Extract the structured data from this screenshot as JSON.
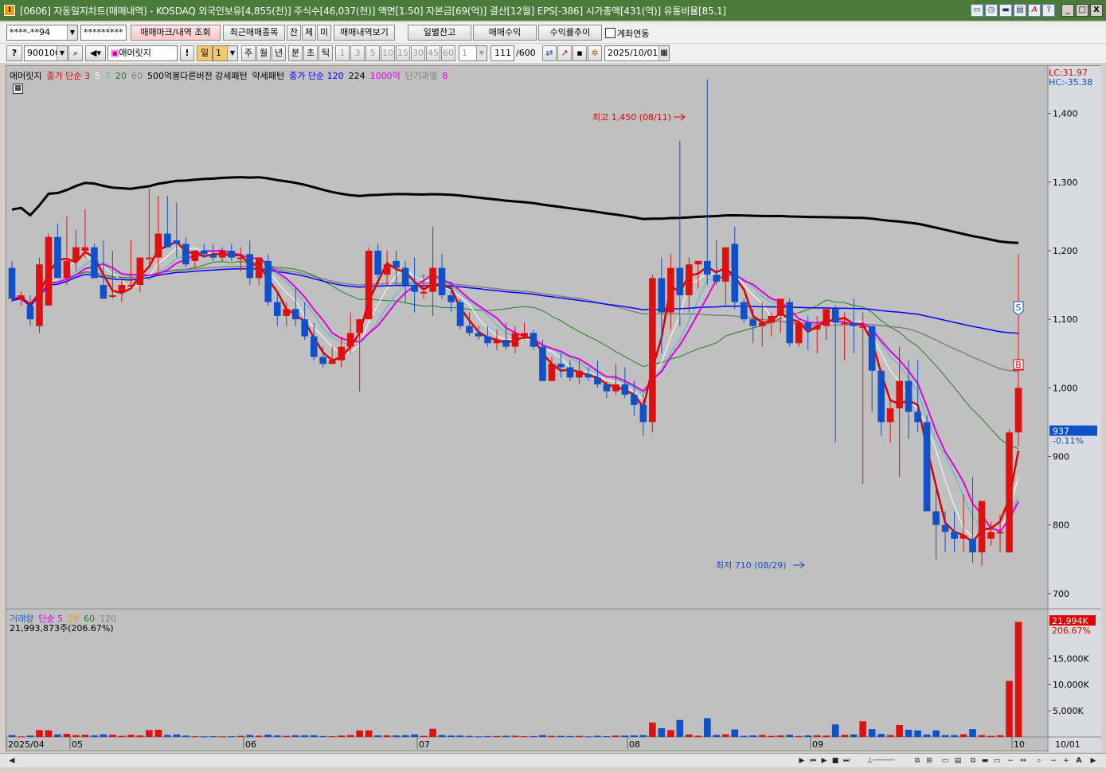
{
  "window": {
    "title": "[0606] 자동일지차트(매매내역) - KOSDAQ 외국인보유[4,855(천)] 주식수[46,037(천)] 액면[1.50] 자본금[69(억)] 결산[12월] EPS[-386] 시가총액[431(억)] 유통비율[85.1]",
    "controls": [
      "▭",
      "◷",
      "▬",
      "▤",
      "A",
      "?",
      "_",
      "□",
      "X"
    ]
  },
  "toolbar1": {
    "account": "****-**94",
    "password": "*********",
    "btn_mark": "매매마크/내역 조회",
    "btn_recent": "최근매매종목",
    "small": [
      "잔",
      "체",
      "미"
    ],
    "btn_history": "매매내역보기",
    "btn_balance": "일별잔고",
    "btn_profit": "매매수익",
    "btn_rate": "수익률추이",
    "chk_link": "계좌연동"
  },
  "toolbar2": {
    "code": "900100",
    "name": "애머릿지",
    "periods": [
      "일",
      "1",
      "주",
      "월",
      "년",
      "분",
      "초",
      "틱"
    ],
    "nums": [
      "1",
      "3",
      "5",
      "10",
      "15",
      "30",
      "45",
      "60"
    ],
    "interval": "1",
    "count": "111",
    "max": "/600",
    "date": "2025/10/01"
  },
  "price_legend": [
    {
      "text": "애머릿지",
      "color": "#000000"
    },
    {
      "text": "종가 단순 3",
      "color": "#e00000"
    },
    {
      "text": "5",
      "color": "#ffffff"
    },
    {
      "text": "7",
      "color": "#40c0c0"
    },
    {
      "text": "20",
      "color": "#208020"
    },
    {
      "text": "60",
      "color": "#808080"
    },
    {
      "text": "500억봉다른버전 강세패턴",
      "color": "#000000"
    },
    {
      "text": "약세패턴",
      "color": "#000000"
    },
    {
      "text": "종가 단순 120",
      "color": "#0000ff"
    },
    {
      "text": "224",
      "color": "#000000"
    },
    {
      "text": "1000억",
      "color": "#e000e0"
    },
    {
      "text": "단기과열",
      "color": "#808080"
    },
    {
      "text": "8",
      "color": "#e000e0"
    }
  ],
  "price_axis": {
    "lc": "LC:31.97",
    "hc": "HC:-35.38",
    "ticks": [
      "1,400",
      "1,300",
      "1,200",
      "1,100",
      "1,000",
      "900",
      "800",
      "700"
    ],
    "current": "937",
    "change": "-0.11%"
  },
  "annotations": {
    "high": "최고 1,450 (08/11)",
    "low": "최저 710 (08/29)",
    "sell_marker": "S",
    "buy_marker": "B"
  },
  "volume_legend": [
    {
      "text": "거래량",
      "color": "#2060c0"
    },
    {
      "text": "단순 5",
      "color": "#e000e0"
    },
    {
      "text": "20",
      "color": "#e0a000"
    },
    {
      "text": "60",
      "color": "#208020"
    },
    {
      "text": "120",
      "color": "#808080"
    }
  ],
  "volume_info": "21,993,873주(206.67%)",
  "volume_axis": {
    "current": "21,994K",
    "pct": "206.67%",
    "ticks": [
      "15,000K",
      "10,000K",
      "5,000K"
    ]
  },
  "date_axis": [
    "2025/04",
    "05",
    "06",
    "07",
    "08",
    "09",
    "10",
    "10/01"
  ],
  "colors": {
    "up": "#e01010",
    "down": "#1050c8",
    "bg": "#c0c0c0"
  },
  "chart_data": {
    "type": "candlestick",
    "x": [
      "04/21",
      "04/22",
      "04/23",
      "04/24",
      "04/25",
      "04/28",
      "04/29",
      "04/30",
      "05/02",
      "05/06",
      "05/07",
      "05/08",
      "05/09",
      "05/12",
      "05/13",
      "05/14",
      "05/15",
      "05/16",
      "05/19",
      "05/20",
      "05/21",
      "05/22",
      "05/23",
      "05/26",
      "05/27",
      "05/28",
      "05/29",
      "05/30",
      "06/02",
      "06/04",
      "06/05",
      "06/09",
      "06/10",
      "06/11",
      "06/12",
      "06/13",
      "06/16",
      "06/17",
      "06/18",
      "06/19",
      "06/20",
      "06/23",
      "06/24",
      "06/25",
      "06/26",
      "06/27",
      "06/30",
      "07/01",
      "07/02",
      "07/03",
      "07/04",
      "07/07",
      "07/08",
      "07/09",
      "07/10",
      "07/11",
      "07/14",
      "07/15",
      "07/16",
      "07/17",
      "07/18",
      "07/21",
      "07/22",
      "07/23",
      "07/24",
      "07/25",
      "07/28",
      "07/29",
      "07/30",
      "07/31",
      "08/01",
      "08/04",
      "08/05",
      "08/06",
      "08/07",
      "08/08",
      "08/11",
      "08/12",
      "08/13",
      "08/14",
      "08/18",
      "08/19",
      "08/20",
      "08/21",
      "08/22",
      "08/25",
      "08/26",
      "08/27",
      "08/28",
      "08/29",
      "09/01",
      "09/02",
      "09/03",
      "09/04",
      "09/05",
      "09/08",
      "09/09",
      "09/10",
      "09/11",
      "09/12",
      "09/15",
      "09/16",
      "09/17",
      "09/18",
      "09/19",
      "09/22",
      "09/23",
      "09/24",
      "09/25",
      "09/26",
      "09/29",
      "09/30",
      "10/01"
    ],
    "ohlc": [
      [
        1175,
        1185,
        1125,
        1130
      ],
      [
        1130,
        1140,
        1120,
        1135
      ],
      [
        1120,
        1135,
        1090,
        1100
      ],
      [
        1090,
        1190,
        1080,
        1180
      ],
      [
        1120,
        1225,
        1120,
        1220
      ],
      [
        1220,
        1240,
        1160,
        1160
      ],
      [
        1160,
        1250,
        1150,
        1185
      ],
      [
        1185,
        1230,
        1170,
        1205
      ],
      [
        1200,
        1260,
        1190,
        1205
      ],
      [
        1205,
        1210,
        1160,
        1160
      ],
      [
        1150,
        1215,
        1130,
        1130
      ],
      [
        1135,
        1200,
        1130,
        1135
      ],
      [
        1140,
        1160,
        1125,
        1150
      ],
      [
        1150,
        1215,
        1145,
        1150
      ],
      [
        1150,
        1190,
        1140,
        1190
      ],
      [
        1190,
        1290,
        1180,
        1190
      ],
      [
        1190,
        1280,
        1165,
        1225
      ],
      [
        1225,
        1280,
        1215,
        1205
      ],
      [
        1215,
        1270,
        1190,
        1210
      ],
      [
        1210,
        1220,
        1175,
        1180
      ],
      [
        1185,
        1200,
        1175,
        1200
      ],
      [
        1200,
        1210,
        1190,
        1195
      ],
      [
        1195,
        1210,
        1185,
        1190
      ],
      [
        1190,
        1205,
        1185,
        1200
      ],
      [
        1200,
        1210,
        1185,
        1190
      ],
      [
        1190,
        1205,
        1170,
        1190
      ],
      [
        1195,
        1215,
        1150,
        1160
      ],
      [
        1160,
        1190,
        1150,
        1190
      ],
      [
        1185,
        1195,
        1120,
        1125
      ],
      [
        1125,
        1140,
        1090,
        1105
      ],
      [
        1105,
        1125,
        1090,
        1115
      ],
      [
        1115,
        1145,
        1090,
        1100
      ],
      [
        1100,
        1125,
        1070,
        1075
      ],
      [
        1075,
        1095,
        1040,
        1045
      ],
      [
        1045,
        1060,
        1030,
        1035
      ],
      [
        1035,
        1060,
        1035,
        1040
      ],
      [
        1040,
        1075,
        1030,
        1060
      ],
      [
        1060,
        1110,
        1050,
        1080
      ],
      [
        1080,
        1100,
        995,
        1100
      ],
      [
        1100,
        1205,
        1100,
        1200
      ],
      [
        1200,
        1210,
        1160,
        1165
      ],
      [
        1165,
        1200,
        1150,
        1180
      ],
      [
        1185,
        1200,
        1150,
        1175
      ],
      [
        1175,
        1185,
        1125,
        1150
      ],
      [
        1150,
        1190,
        1110,
        1140
      ],
      [
        1140,
        1165,
        1130,
        1140
      ],
      [
        1140,
        1235,
        1105,
        1175
      ],
      [
        1175,
        1195,
        1130,
        1135
      ],
      [
        1135,
        1155,
        1110,
        1125
      ],
      [
        1125,
        1130,
        1085,
        1090
      ],
      [
        1090,
        1110,
        1075,
        1080
      ],
      [
        1080,
        1090,
        1070,
        1075
      ],
      [
        1075,
        1090,
        1060,
        1065
      ],
      [
        1065,
        1085,
        1055,
        1070
      ],
      [
        1070,
        1095,
        1055,
        1060
      ],
      [
        1060,
        1090,
        1050,
        1080
      ],
      [
        1075,
        1095,
        1070,
        1080
      ],
      [
        1080,
        1085,
        1055,
        1060
      ],
      [
        1060,
        1070,
        1010,
        1010
      ],
      [
        1010,
        1045,
        1010,
        1035
      ],
      [
        1035,
        1050,
        1015,
        1030
      ],
      [
        1030,
        1040,
        1010,
        1015
      ],
      [
        1015,
        1040,
        1005,
        1025
      ],
      [
        1020,
        1030,
        1010,
        1015
      ],
      [
        1015,
        1040,
        1000,
        1005
      ],
      [
        1005,
        1010,
        985,
        995
      ],
      [
        995,
        1035,
        990,
        1005
      ],
      [
        1005,
        1030,
        985,
        990
      ],
      [
        990,
        1010,
        960,
        975
      ],
      [
        975,
        990,
        930,
        950
      ],
      [
        950,
        1165,
        935,
        1160
      ],
      [
        1160,
        1190,
        1050,
        1110
      ],
      [
        1110,
        1195,
        1085,
        1175
      ],
      [
        1175,
        1360,
        1090,
        1135
      ],
      [
        1135,
        1190,
        1110,
        1180
      ],
      [
        1180,
        1185,
        1145,
        1185
      ],
      [
        1185,
        1450,
        1150,
        1165
      ],
      [
        1165,
        1215,
        1150,
        1155
      ],
      [
        1155,
        1205,
        1120,
        1205
      ],
      [
        1210,
        1235,
        1115,
        1125
      ],
      [
        1125,
        1130,
        1095,
        1100
      ],
      [
        1100,
        1115,
        1065,
        1090
      ],
      [
        1090,
        1125,
        1060,
        1095
      ],
      [
        1095,
        1110,
        1075,
        1105
      ],
      [
        1105,
        1130,
        1080,
        1130
      ],
      [
        1125,
        1130,
        1060,
        1065
      ],
      [
        1065,
        1090,
        1060,
        1095
      ],
      [
        1095,
        1105,
        1055,
        1085
      ],
      [
        1085,
        1105,
        1050,
        1090
      ],
      [
        1090,
        1115,
        1070,
        1115
      ],
      [
        1115,
        1120,
        920,
        1095
      ],
      [
        1095,
        1110,
        1040,
        1095
      ],
      [
        1095,
        1130,
        1050,
        1090
      ],
      [
        1090,
        1110,
        860,
        1090
      ],
      [
        1090,
        1090,
        965,
        1025
      ],
      [
        1025,
        1025,
        930,
        950
      ],
      [
        950,
        980,
        920,
        970
      ],
      [
        970,
        1060,
        870,
        1010
      ],
      [
        1010,
        1040,
        925,
        965
      ],
      [
        965,
        1040,
        935,
        950
      ],
      [
        950,
        960,
        880,
        820
      ],
      [
        820,
        855,
        750,
        800
      ],
      [
        800,
        820,
        760,
        790
      ],
      [
        790,
        820,
        760,
        780
      ],
      [
        780,
        845,
        760,
        785
      ],
      [
        780,
        870,
        745,
        760
      ],
      [
        760,
        800,
        740,
        835
      ],
      [
        780,
        805,
        770,
        790
      ],
      [
        790,
        815,
        760,
        790
      ],
      [
        760,
        940,
        760,
        935
      ],
      [
        935,
        1195,
        915,
        1000
      ]
    ],
    "ylim": [
      680,
      1460
    ]
  }
}
